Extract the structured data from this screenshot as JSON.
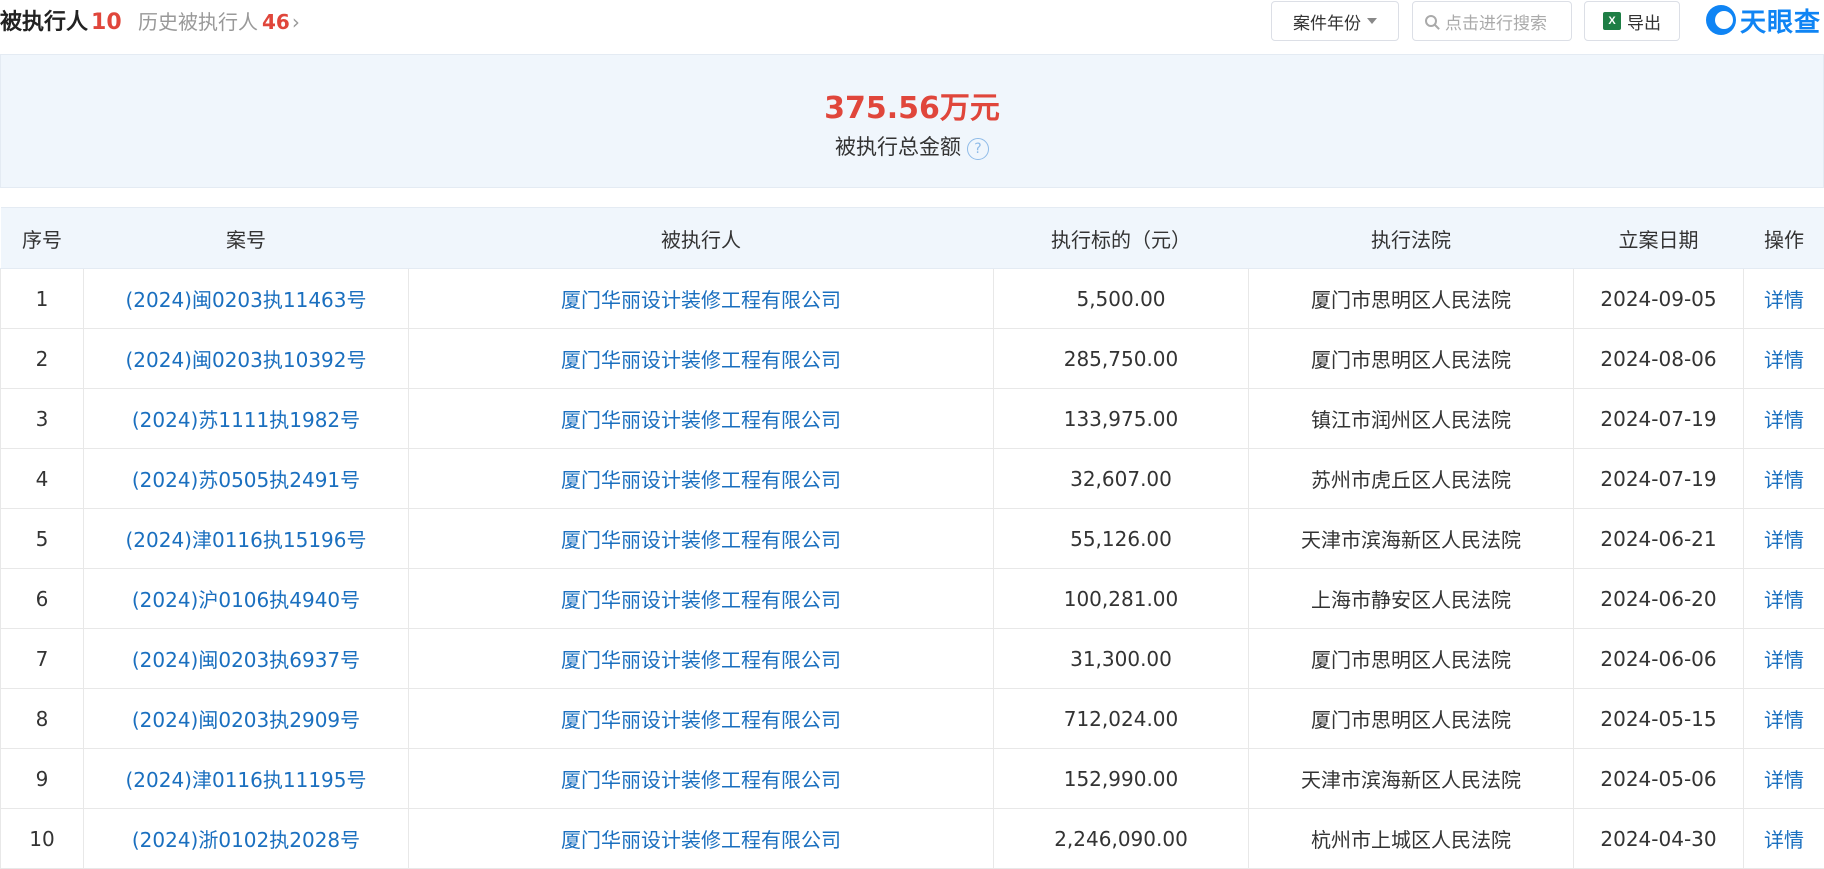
{
  "header": {
    "title": "被执行人",
    "title_count": "10",
    "history_label": "历史被执行人",
    "history_count": "46",
    "history_chevron": "›",
    "year_filter_label": "案件年份",
    "search_placeholder": "点击进行搜索",
    "export_label": "导出",
    "export_icon_text": "X",
    "logo_text": "天眼查"
  },
  "summary": {
    "amount": "375.56万元",
    "label": "被执行总金额",
    "help_icon": "?"
  },
  "table": {
    "columns": [
      "序号",
      "案号",
      "被执行人",
      "执行标的（元）",
      "执行法院",
      "立案日期",
      "操作"
    ],
    "rows": [
      {
        "no": "1",
        "case_no": "(2024)闽0203执11463号",
        "party": "厦门华丽设计装修工程有限公司",
        "amount": "5,500.00",
        "court": "厦门市思明区人民法院",
        "date": "2024-09-05",
        "action": "详情"
      },
      {
        "no": "2",
        "case_no": "(2024)闽0203执10392号",
        "party": "厦门华丽设计装修工程有限公司",
        "amount": "285,750.00",
        "court": "厦门市思明区人民法院",
        "date": "2024-08-06",
        "action": "详情"
      },
      {
        "no": "3",
        "case_no": "(2024)苏1111执1982号",
        "party": "厦门华丽设计装修工程有限公司",
        "amount": "133,975.00",
        "court": "镇江市润州区人民法院",
        "date": "2024-07-19",
        "action": "详情"
      },
      {
        "no": "4",
        "case_no": "(2024)苏0505执2491号",
        "party": "厦门华丽设计装修工程有限公司",
        "amount": "32,607.00",
        "court": "苏州市虎丘区人民法院",
        "date": "2024-07-19",
        "action": "详情"
      },
      {
        "no": "5",
        "case_no": "(2024)津0116执15196号",
        "party": "厦门华丽设计装修工程有限公司",
        "amount": "55,126.00",
        "court": "天津市滨海新区人民法院",
        "date": "2024-06-21",
        "action": "详情"
      },
      {
        "no": "6",
        "case_no": "(2024)沪0106执4940号",
        "party": "厦门华丽设计装修工程有限公司",
        "amount": "100,281.00",
        "court": "上海市静安区人民法院",
        "date": "2024-06-20",
        "action": "详情"
      },
      {
        "no": "7",
        "case_no": "(2024)闽0203执6937号",
        "party": "厦门华丽设计装修工程有限公司",
        "amount": "31,300.00",
        "court": "厦门市思明区人民法院",
        "date": "2024-06-06",
        "action": "详情"
      },
      {
        "no": "8",
        "case_no": "(2024)闽0203执2909号",
        "party": "厦门华丽设计装修工程有限公司",
        "amount": "712,024.00",
        "court": "厦门市思明区人民法院",
        "date": "2024-05-15",
        "action": "详情"
      },
      {
        "no": "9",
        "case_no": "(2024)津0116执11195号",
        "party": "厦门华丽设计装修工程有限公司",
        "amount": "152,990.00",
        "court": "天津市滨海新区人民法院",
        "date": "2024-05-06",
        "action": "详情"
      },
      {
        "no": "10",
        "case_no": "(2024)浙0102执2028号",
        "party": "厦门华丽设计装修工程有限公司",
        "amount": "2,246,090.00",
        "court": "杭州市上城区人民法院",
        "date": "2024-04-30",
        "action": "详情"
      }
    ]
  },
  "colors": {
    "accent_red": "#e0463b",
    "link_blue": "#1a6fbf",
    "brand_blue": "#0f84f4",
    "header_bg": "#f0f6fc"
  }
}
